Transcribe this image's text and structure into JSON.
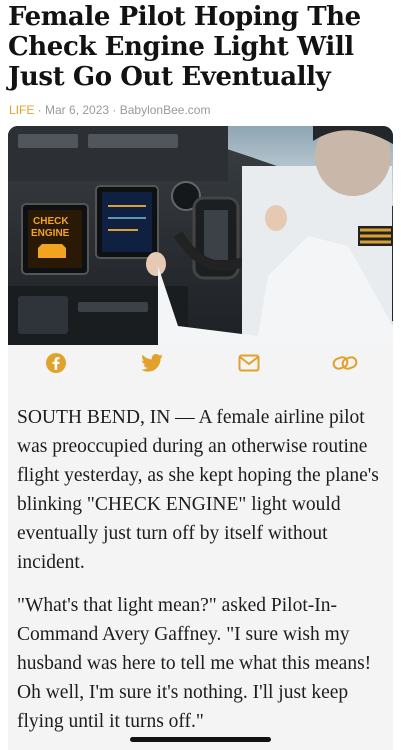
{
  "article": {
    "headline": "Female Pilot Hoping The Check Engine Light Will Just Go Out Eventually",
    "category": "LIFE",
    "separator": " · ",
    "date": "Mar 6, 2023",
    "source": "BabylonBee.com",
    "image": {
      "warning_line1": "CHECK",
      "warning_line2": "ENGINE"
    },
    "paragraphs": [
      "SOUTH BEND, IN — A female airline pilot was preoccupied during an otherwise routine flight yesterday, as she kept hoping the plane's blinking \"CHECK ENGINE\" light would eventually just turn off by itself without incident.",
      "\"What's that light mean?\" asked Pilot-In-Command Avery Gaffney. \"I sure wish my husband was here to tell me what this means! Oh well, I'm sure it's nothing. I'll just keep flying until it turns off.\""
    ]
  },
  "share": {
    "accent_color": "#e2a12b",
    "icons": [
      "facebook-icon",
      "twitter-icon",
      "email-icon",
      "link-icon"
    ]
  }
}
